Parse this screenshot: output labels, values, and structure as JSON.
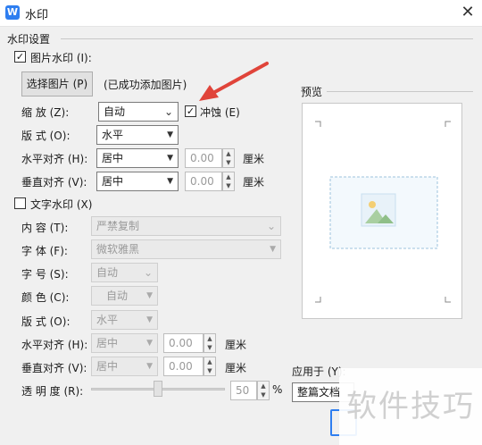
{
  "window": {
    "title": "水印",
    "icon_glyph": "W",
    "close_glyph": "✕"
  },
  "settings": {
    "group_label": "水印设置"
  },
  "picture": {
    "checkbox_label": "图片水印 (I):",
    "checked": true,
    "select_button": "选择图片 (P)",
    "status": "(已成功添加图片)",
    "scale_label": "缩 放 (Z):",
    "scale_value": "自动",
    "washout_label": "冲蚀 (E)",
    "washout_checked": true,
    "layout_label": "版 式 (O):",
    "layout_value": "水平",
    "halign_label": "水平对齐 (H):",
    "halign_value": "居中",
    "halign_offset": "0.00",
    "valign_label": "垂直对齐 (V):",
    "valign_value": "居中",
    "valign_offset": "0.00",
    "unit": "厘米"
  },
  "text": {
    "checkbox_label": "文字水印 (X)",
    "checked": false,
    "content_label": "内 容 (T):",
    "content_value": "严禁复制",
    "font_label": "字 体 (F):",
    "font_value": "微软雅黑",
    "size_label": "字 号 (S):",
    "size_value": "自动",
    "color_label": "颜 色 (C):",
    "color_value": "自动",
    "layout_label": "版 式 (O):",
    "layout_value": "水平",
    "halign_label": "水平对齐 (H):",
    "halign_value": "居中",
    "halign_offset": "0.00",
    "valign_label": "垂直对齐 (V):",
    "valign_value": "居中",
    "valign_offset": "0.00",
    "unit": "厘米",
    "transparency_label": "透 明 度 (R):",
    "transparency_value": "50",
    "transparency_unit": "%",
    "transparency_level": 0.5
  },
  "preview": {
    "label": "预览"
  },
  "apply": {
    "label": "应用于 (Y):",
    "value": "整篇文档"
  },
  "overlay": {
    "text": "软件技巧"
  },
  "colors": {
    "accent": "#2e7ef0",
    "arrow": "#e0443a",
    "dashed": "#9cc3dd"
  },
  "icons": {
    "check": "✓",
    "dropdown": "▼",
    "spin_up": "▲",
    "spin_down": "▼"
  }
}
